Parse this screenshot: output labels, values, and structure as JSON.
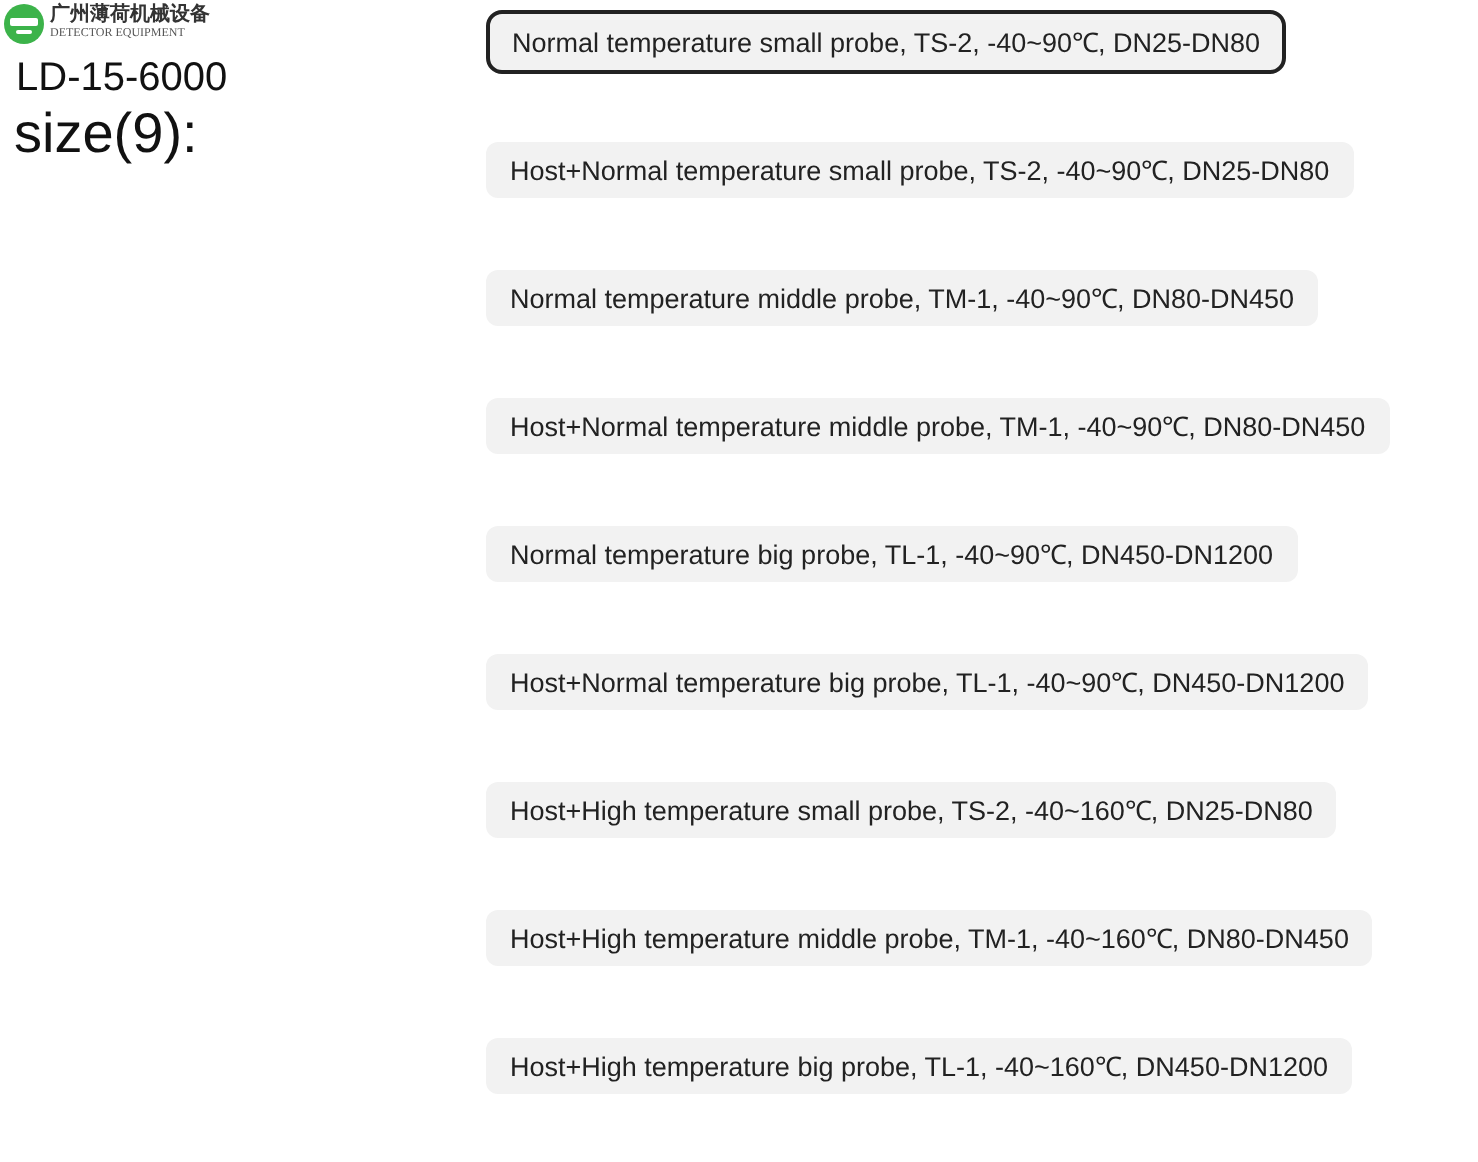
{
  "logo": {
    "company": "广州薄荷机械设备",
    "tagline": "DETECTOR EQUIPMENT"
  },
  "model": "LD-15-6000",
  "size_label": "size(9):",
  "options": [
    {
      "label": "Normal temperature small probe, TS-2, -40~90℃, DN25-DN80",
      "selected": true
    },
    {
      "label": "Host+Normal temperature small probe, TS-2, -40~90℃, DN25-DN80",
      "selected": false
    },
    {
      "label": "Normal temperature middle probe, TM-1, -40~90℃, DN80-DN450",
      "selected": false
    },
    {
      "label": "Host+Normal temperature middle probe, TM-1, -40~90℃, DN80-DN450",
      "selected": false
    },
    {
      "label": "Normal temperature big probe, TL-1, -40~90℃, DN450-DN1200",
      "selected": false
    },
    {
      "label": "Host+Normal temperature big probe, TL-1, -40~90℃, DN450-DN1200",
      "selected": false
    },
    {
      "label": "Host+High temperature small probe, TS-2, -40~160℃, DN25-DN80",
      "selected": false
    },
    {
      "label": "Host+High temperature middle probe, TM-1, -40~160℃, DN80-DN450",
      "selected": false
    },
    {
      "label": "Host+High temperature big probe, TL-1, -40~160℃, DN450-DN1200",
      "selected": false
    }
  ]
}
